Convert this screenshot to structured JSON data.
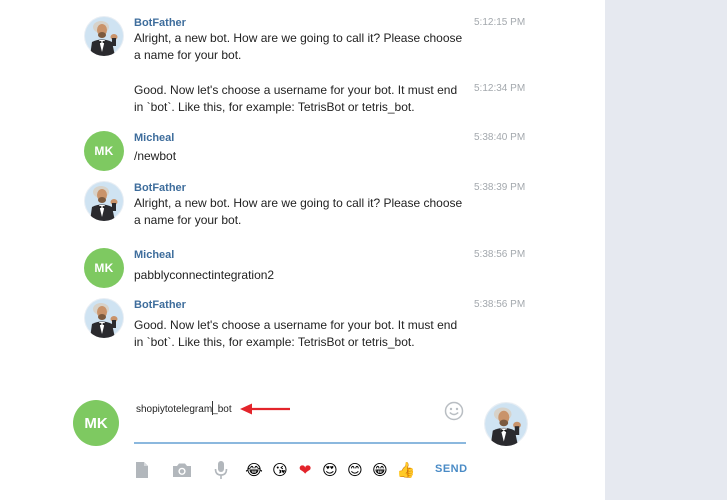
{
  "messages": [
    {
      "sender": "BotFather",
      "time": "5:12:15 PM",
      "text": "Alright, a new bot. How are we going to call it? Please choose a name for your bot.",
      "avatar": "botfather"
    },
    {
      "sender": "",
      "time": "5:12:34 PM",
      "text": "Good. Now let's choose a username for your bot. It must end in `bot`. Like this, for example: TetrisBot or tetris_bot.",
      "avatar": ""
    },
    {
      "sender": "Micheal",
      "time": "5:38:40 PM",
      "text": "/newbot",
      "avatar": "MK"
    },
    {
      "sender": "BotFather",
      "time": "5:38:39 PM",
      "text": "Alright, a new bot. How are we going to call it? Please choose a name for your bot.",
      "avatar": "botfather"
    },
    {
      "sender": "Micheal",
      "time": "5:38:56 PM",
      "text": "pabblyconnectintegration2",
      "avatar": "MK"
    },
    {
      "sender": "BotFather",
      "time": "5:38:56 PM",
      "text": "Good. Now let's choose a username for your bot. It must end in `bot`. Like this, for example: TetrisBot or tetris_bot.",
      "avatar": "botfather"
    }
  ],
  "composer": {
    "user_initials": "MK",
    "input_value": "shopiytotelegram_bot",
    "send_label": "SEND",
    "emoji_icon": "smiley-icon"
  },
  "toolbar": {
    "icons": [
      "document-icon",
      "camera-icon",
      "microphone-icon"
    ],
    "quick_emojis": [
      "😂",
      "😘",
      "❤",
      "😍",
      "😊",
      "😁",
      "👍"
    ]
  },
  "colors": {
    "avatar_green": "#7ec961",
    "sender_blue": "#3e6d9c",
    "send_blue": "#4a8bc6",
    "input_underline": "#8bb8de",
    "arrow_red": "#e3242b",
    "right_panel": "#e6e9f0"
  }
}
